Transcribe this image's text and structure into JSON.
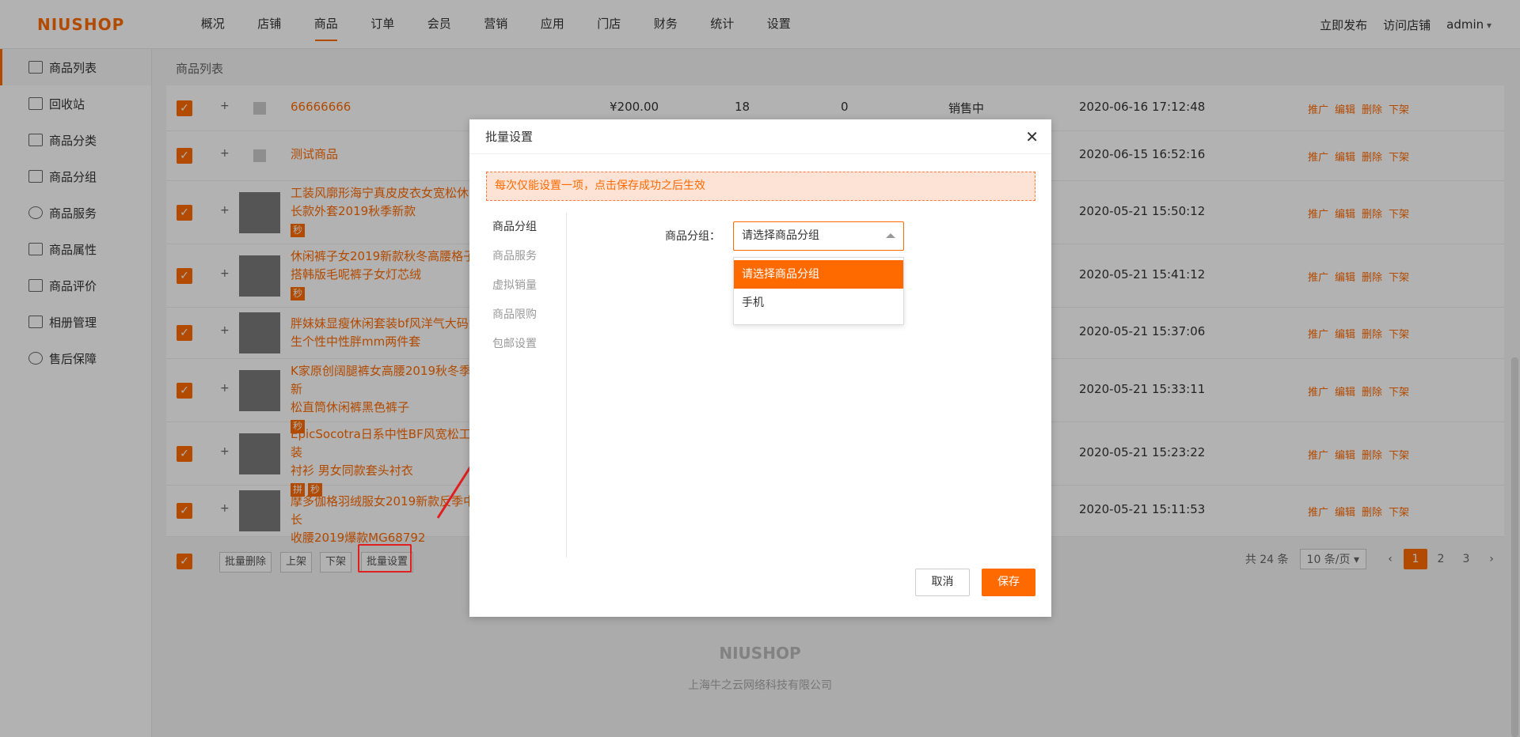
{
  "brand": {
    "logo": "NIUSHOP",
    "accent": "#ff6a00"
  },
  "nav": [
    "概况",
    "店铺",
    "商品",
    "订单",
    "会员",
    "营销",
    "应用",
    "门店",
    "财务",
    "统计",
    "设置"
  ],
  "top_right": {
    "publish": "立即发布",
    "visit": "访问店铺",
    "user": "admin"
  },
  "sidebar": [
    {
      "label": "商品列表",
      "icon": "gift-icon"
    },
    {
      "label": "回收站",
      "icon": "trash-icon"
    },
    {
      "label": "商品分类",
      "icon": "grid-icon"
    },
    {
      "label": "商品分组",
      "icon": "bag-icon"
    },
    {
      "label": "商品服务",
      "icon": "smile-icon"
    },
    {
      "label": "商品属性",
      "icon": "list-icon"
    },
    {
      "label": "商品评价",
      "icon": "edit-icon"
    },
    {
      "label": "相册管理",
      "icon": "image-icon"
    },
    {
      "label": "售后保障",
      "icon": "shield-icon"
    }
  ],
  "breadcrumb": "商品列表",
  "products": [
    {
      "name": "66666666",
      "price": "¥200.00",
      "stock": "18",
      "sales": "0",
      "status": "销售中",
      "date": "2020-06-16 17:12:48",
      "tags": []
    },
    {
      "name": "测试商品",
      "date": "2020-06-15 16:52:16",
      "tags": []
    },
    {
      "name": "工装风廓形海宁真皮皮衣女宽松休闲",
      "name2": "长款外套2019秋季新款",
      "date": "2020-05-21 15:50:12",
      "tags": [
        "秒"
      ]
    },
    {
      "name": "休闲裤子女2019新款秋冬高腰格子",
      "name2": "搭韩版毛呢裤子女灯芯绒",
      "date": "2020-05-21 15:41:12",
      "tags": [
        "秒"
      ]
    },
    {
      "name": "胖妹妹显瘦休闲套装bf风洋气大码女",
      "name2": "生个性中性胖mm两件套",
      "date": "2020-05-21 15:37:06",
      "tags": []
    },
    {
      "name": "K家原创阔腿裤女高腰2019秋冬季新",
      "name2": "松直筒休闲裤黑色裤子",
      "date": "2020-05-21 15:33:11",
      "tags": [
        "秒"
      ]
    },
    {
      "name": "EpicSocotra日系中性BF风宽松工装",
      "name2": "衬衫 男女同款套头衬衣",
      "date": "2020-05-21 15:23:22",
      "tags": [
        "拼",
        "秒"
      ]
    },
    {
      "name": "摩多伽格羽绒服女2019新款反季中长",
      "name2": "收腰2019爆款MG68792",
      "date": "2020-05-21 15:11:53",
      "tags": []
    }
  ],
  "row_ops": [
    "推广",
    "编辑",
    "删除",
    "下架"
  ],
  "bulk": {
    "delete": "批量删除",
    "on": "上架",
    "off": "下架",
    "setting": "批量设置"
  },
  "pager": {
    "total": "共 24 条",
    "size": "10 条/页 ▾",
    "pages": [
      "1",
      "2",
      "3"
    ],
    "prev": "‹",
    "next": "›"
  },
  "site_footer": {
    "logo": "NIUSHOP",
    "company": "上海牛之云网络科技有限公司"
  },
  "modal": {
    "title": "批量设置",
    "close": "✕",
    "notice": "每次仅能设置一项，点击保存成功之后生效",
    "tabs": [
      "商品分组",
      "商品服务",
      "虚拟销量",
      "商品限购",
      "包邮设置"
    ],
    "field_label": "商品分组：",
    "select_value": "请选择商品分组",
    "options": [
      "请选择商品分组",
      "手机"
    ],
    "cancel": "取消",
    "save": "保存"
  }
}
